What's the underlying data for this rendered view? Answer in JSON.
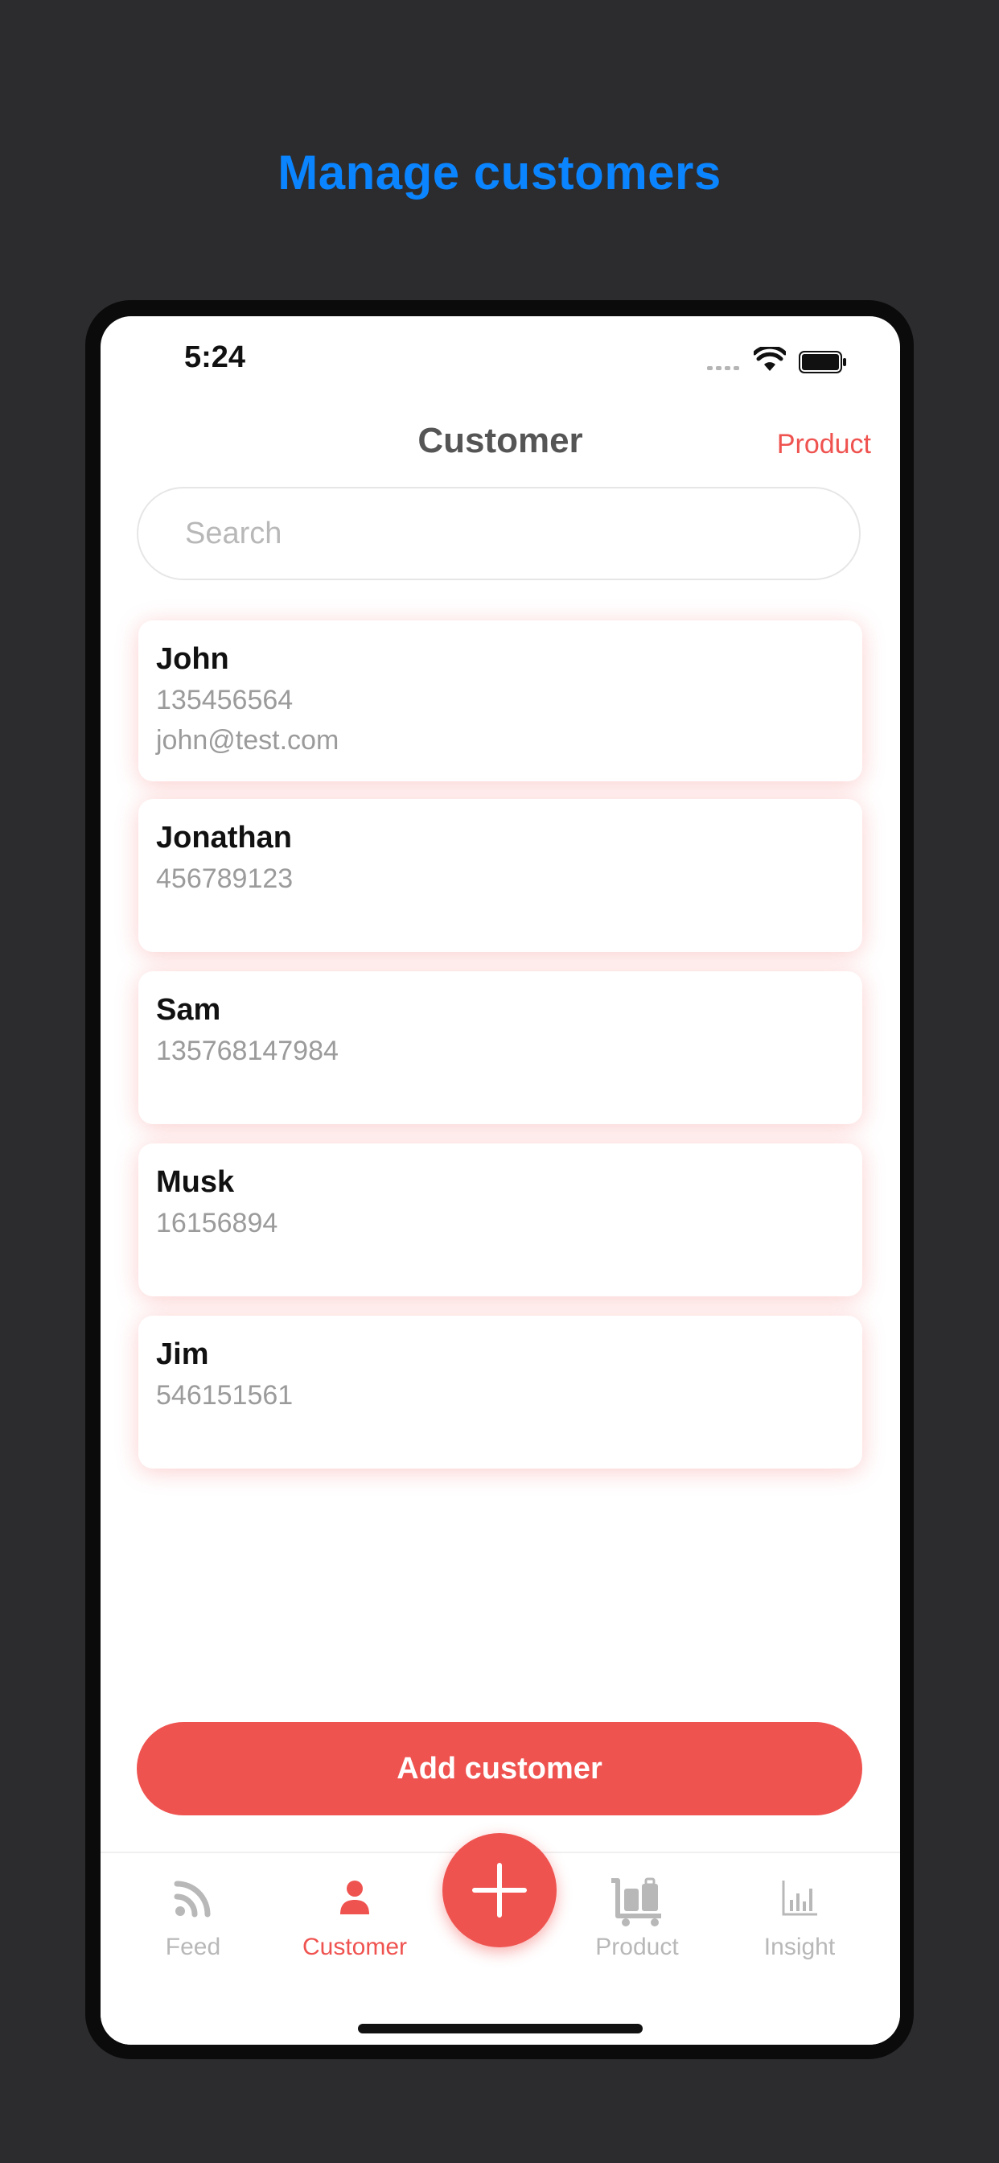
{
  "promo": {
    "title": "Manage customers"
  },
  "status_bar": {
    "time": "5:24"
  },
  "header": {
    "title": "Customer",
    "right_action": "Product"
  },
  "search": {
    "placeholder": "Search",
    "value": ""
  },
  "customers": [
    {
      "name": "John",
      "phone": "135456564",
      "email": "john@test.com"
    },
    {
      "name": "Jonathan",
      "phone": "456789123",
      "email": ""
    },
    {
      "name": "Sam",
      "phone": "135768147984",
      "email": ""
    },
    {
      "name": "Musk",
      "phone": "16156894",
      "email": ""
    },
    {
      "name": "Jim",
      "phone": "546151561",
      "email": ""
    }
  ],
  "add_button": {
    "label": "Add customer"
  },
  "tab_bar": {
    "tabs": [
      {
        "label": "Feed",
        "icon": "rss-icon",
        "active": false
      },
      {
        "label": "Customer",
        "icon": "person-icon",
        "active": true
      },
      {
        "label": "Product",
        "icon": "luggage-cart-icon",
        "active": false
      },
      {
        "label": "Insight",
        "icon": "bar-chart-icon",
        "active": false
      }
    ],
    "fab_icon": "plus-icon"
  },
  "colors": {
    "background": "#2c2c2e",
    "promo_title": "#0a84ff",
    "accent": "#ef5350",
    "inactive": "#b8b8b8"
  }
}
